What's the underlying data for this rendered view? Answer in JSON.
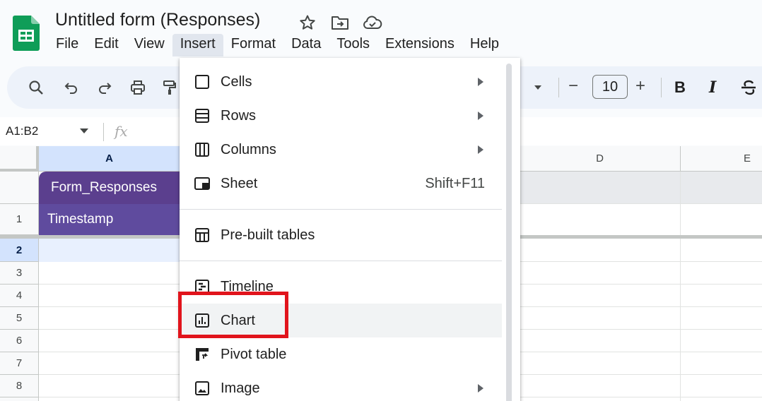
{
  "app": {
    "title": "Untitled form (Responses)",
    "brand_color": "#0f9d58"
  },
  "menubar": {
    "items": [
      "File",
      "Edit",
      "View",
      "Insert",
      "Format",
      "Data",
      "Tools",
      "Extensions",
      "Help"
    ],
    "active": "Insert"
  },
  "toolbar": {
    "font_size": "10",
    "minus": "−",
    "plus": "+",
    "bold": "B",
    "italic": "I"
  },
  "formula_bar": {
    "name_box": "A1:B2",
    "fx_label": "fx"
  },
  "grid": {
    "columns": [
      "A",
      "D",
      "E"
    ],
    "rows": [
      "1",
      "2",
      "3",
      "4",
      "5",
      "6",
      "7",
      "8"
    ],
    "table_name": "Form_Responses",
    "column_name": "Timestamp"
  },
  "insert_menu": {
    "items": [
      {
        "label": "Cells",
        "submenu": true
      },
      {
        "label": "Rows",
        "submenu": true
      },
      {
        "label": "Columns",
        "submenu": true
      },
      {
        "label": "Sheet",
        "shortcut": "Shift+F11"
      },
      {
        "label": "Pre-built tables"
      },
      {
        "label": "Timeline"
      },
      {
        "label": "Chart",
        "highlighted": true
      },
      {
        "label": "Pivot table"
      },
      {
        "label": "Image",
        "submenu": true
      }
    ],
    "highlight_color": "#e1141c"
  }
}
